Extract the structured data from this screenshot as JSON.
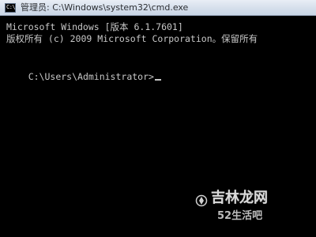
{
  "window": {
    "title": "管理员: C:\\Windows\\system32\\cmd.exe",
    "icon_name": "command-prompt-icon",
    "icon_text": "C:\\"
  },
  "console": {
    "lines": [
      "Microsoft Windows [版本 6.1.7601]",
      "版权所有 (c) 2009 Microsoft Corporation。保留所有",
      "C:\\Users\\Administrator>"
    ],
    "cursor_visible": true
  },
  "watermark": {
    "main_text": "吉林龙网",
    "sub_text": "52生活吧"
  },
  "colors": {
    "console_background": "#000000",
    "console_text": "#c8c8c8",
    "titlebar_top": "#e9eef6",
    "titlebar_bottom": "#c9d5e6"
  }
}
